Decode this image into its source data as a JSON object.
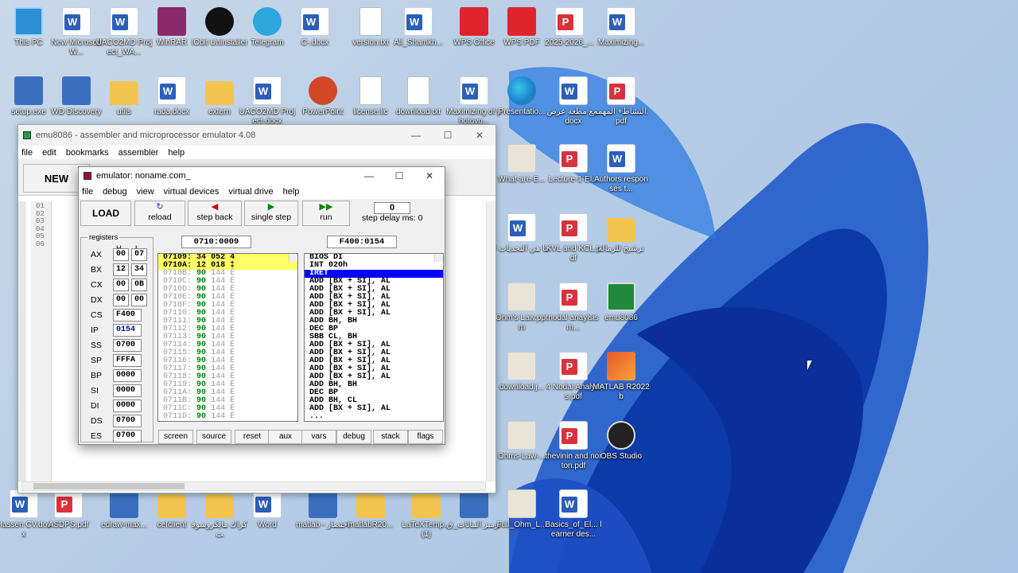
{
  "desktop": {
    "icons": [
      {
        "label": "This PC",
        "type": "pc"
      },
      {
        "label": "New Microsoft W...",
        "type": "word"
      },
      {
        "label": "UACO2MD Project_WA...",
        "type": "word"
      },
      {
        "label": "WinRAR",
        "type": "winrar"
      },
      {
        "label": "IObit Uninstaller",
        "type": "iobit"
      },
      {
        "label": "Telegram",
        "type": "tg"
      },
      {
        "label": "C-.docx",
        "type": "word"
      },
      {
        "label": "version.txt",
        "type": "txt"
      },
      {
        "label": "Ali_Shamkh...",
        "type": "word"
      },
      {
        "label": "WPS Office",
        "type": "wps"
      },
      {
        "label": "WPS PDF",
        "type": "wps"
      },
      {
        "label": "2025-2026_...",
        "type": "pdf"
      },
      {
        "label": "Maximizing...",
        "type": "word"
      },
      {
        "label": "setup.exe",
        "type": "app"
      },
      {
        "label": "WD Discovery",
        "type": "app"
      },
      {
        "label": "utils",
        "type": "folder"
      },
      {
        "label": "rada.docx",
        "type": "word"
      },
      {
        "label": "extern",
        "type": "folder"
      },
      {
        "label": "UACO2MD Project.docx",
        "type": "word"
      },
      {
        "label": "PowerPoint",
        "type": "ppt"
      },
      {
        "label": "license.lic",
        "type": "txt"
      },
      {
        "label": "download.txt",
        "type": "txt"
      },
      {
        "label": "Maximizing of photovo...",
        "type": "word"
      },
      {
        "label": "Presentatio...",
        "type": "edge"
      },
      {
        "label": "بيع مطعة عرض.docx",
        "type": "word"
      },
      {
        "label": "النشاط+ المهمه.pdf",
        "type": "pdf"
      },
      {
        "label": "What-are-E...",
        "type": "img"
      },
      {
        "label": "Lecture-1-El...",
        "type": "pdf"
      },
      {
        "label": "Authors responses t...",
        "type": "word"
      },
      {
        "label": "ما هي التحديات ا",
        "type": "word"
      },
      {
        "label": "KVL and KCL.pdf",
        "type": "pdf"
      },
      {
        "label": "ترشيح للزمالة",
        "type": "folder"
      },
      {
        "label": "Ohm's Law.pptm",
        "type": "img"
      },
      {
        "label": "nodal anaylsis m...",
        "type": "pdf"
      },
      {
        "label": "emu8086",
        "type": "chip"
      },
      {
        "label": "download.j...",
        "type": "img"
      },
      {
        "label": "4 Nodal Analysis.pdf",
        "type": "pdf"
      },
      {
        "label": "MATLAB R2022b",
        "type": "matlab"
      },
      {
        "label": "Ohms-Law-...",
        "type": "img"
      },
      {
        "label": "thevinin and norton.pdf",
        "type": "pdf"
      },
      {
        "label": "OBS Studio",
        "type": "obs"
      },
      {
        "label": "Hassen CV.docx",
        "type": "word"
      },
      {
        "label": "ASDPS.pdf",
        "type": "pdf"
      },
      {
        "label": "edraw-max...",
        "type": "app"
      },
      {
        "label": "cefclient",
        "type": "folder"
      },
      {
        "label": "كراك مايكروسوفت",
        "type": "folder"
      },
      {
        "label": "Word",
        "type": "word"
      },
      {
        "label": "matlab - اختصار",
        "type": "app"
      },
      {
        "label": "matlabR20...",
        "type": "folder"
      },
      {
        "label": "LaTeXTemp... (1)",
        "type": "folder"
      },
      {
        "label": "ترميز البيانات_ق",
        "type": "app"
      },
      {
        "label": "Full_Ohm_L...",
        "type": "img"
      },
      {
        "label": "Basics_of_El... learner des...",
        "type": "word"
      }
    ]
  },
  "outer_window": {
    "title": "emu8086 - assembler and microprocessor emulator 4.08",
    "menu": [
      "file",
      "edit",
      "bookmarks",
      "assembler",
      "help"
    ],
    "new_label": "NEW",
    "line_numbers": [
      "01",
      "02",
      "03",
      "04",
      "05",
      "06"
    ]
  },
  "emulator": {
    "title": "emulator: noname.com_",
    "menu": [
      "file",
      "debug",
      "view",
      "virtual devices",
      "virtual drive",
      "help"
    ],
    "load_label": "LOAD",
    "reload_label": "reload",
    "step_back_label": "step back",
    "single_step_label": "single step",
    "run_label": "run",
    "step_delay_label": "step delay ms: 0",
    "step_delay_value": "0",
    "mem_address": "0710:0009",
    "dis_address": "F400:0154",
    "registers_title": "registers",
    "col_h": "H",
    "col_l": "L",
    "registers": [
      {
        "name": "AX",
        "h": "00",
        "l": "07"
      },
      {
        "name": "BX",
        "h": "12",
        "l": "34"
      },
      {
        "name": "CX",
        "h": "00",
        "l": "0B"
      },
      {
        "name": "DX",
        "h": "00",
        "l": "00"
      },
      {
        "name": "CS",
        "v": "F400"
      },
      {
        "name": "IP",
        "v": "0154"
      },
      {
        "name": "SS",
        "v": "0700"
      },
      {
        "name": "SP",
        "v": "FFFA"
      },
      {
        "name": "BP",
        "v": "0000"
      },
      {
        "name": "SI",
        "v": "0000"
      },
      {
        "name": "DI",
        "v": "0000"
      },
      {
        "name": "DS",
        "v": "0700"
      },
      {
        "name": "ES",
        "v": "0700"
      }
    ],
    "memory": [
      {
        "addr": "07109:",
        "hex": "34",
        "dec": "052",
        "ch": "4",
        "hl": true
      },
      {
        "addr": "0710A:",
        "hex": "12",
        "dec": "018",
        "ch": "‡",
        "hl": true
      },
      {
        "addr": "0710B:",
        "hex": "90",
        "dec": "144",
        "ch": "É"
      },
      {
        "addr": "0710C:",
        "hex": "90",
        "dec": "144",
        "ch": "É"
      },
      {
        "addr": "0710D:",
        "hex": "90",
        "dec": "144",
        "ch": "É"
      },
      {
        "addr": "0710E:",
        "hex": "90",
        "dec": "144",
        "ch": "É"
      },
      {
        "addr": "0710F:",
        "hex": "90",
        "dec": "144",
        "ch": "É"
      },
      {
        "addr": "07110:",
        "hex": "90",
        "dec": "144",
        "ch": "É"
      },
      {
        "addr": "07111:",
        "hex": "90",
        "dec": "144",
        "ch": "É"
      },
      {
        "addr": "07112:",
        "hex": "90",
        "dec": "144",
        "ch": "É"
      },
      {
        "addr": "07113:",
        "hex": "90",
        "dec": "144",
        "ch": "É"
      },
      {
        "addr": "07114:",
        "hex": "90",
        "dec": "144",
        "ch": "É"
      },
      {
        "addr": "07115:",
        "hex": "90",
        "dec": "144",
        "ch": "É"
      },
      {
        "addr": "07116:",
        "hex": "90",
        "dec": "144",
        "ch": "É"
      },
      {
        "addr": "07117:",
        "hex": "90",
        "dec": "144",
        "ch": "É"
      },
      {
        "addr": "07118:",
        "hex": "90",
        "dec": "144",
        "ch": "É"
      },
      {
        "addr": "07119:",
        "hex": "90",
        "dec": "144",
        "ch": "É"
      },
      {
        "addr": "0711A:",
        "hex": "90",
        "dec": "144",
        "ch": "É"
      },
      {
        "addr": "0711B:",
        "hex": "90",
        "dec": "144",
        "ch": "É"
      },
      {
        "addr": "0711C:",
        "hex": "90",
        "dec": "144",
        "ch": "É"
      },
      {
        "addr": "0711D:",
        "hex": "90",
        "dec": "144",
        "ch": "É"
      }
    ],
    "disassembly": [
      "BIOS DI",
      "INT 020h",
      "IRET",
      "ADD [BX + SI], AL",
      "ADD [BX + SI], AL",
      "ADD [BX + SI], AL",
      "ADD [BX + SI], AL",
      "ADD [BX + SI], AL",
      "ADD BH, BH",
      "DEC BP",
      "SBB CL, BH",
      "ADD [BX + SI], AL",
      "ADD [BX + SI], AL",
      "ADD [BX + SI], AL",
      "ADD [BX + SI], AL",
      "ADD [BX + SI], AL",
      "ADD BH, BH",
      "DEC BP",
      "ADD BH, CL",
      "ADD [BX + SI], AL",
      "..."
    ],
    "selected_dis_index": 2,
    "bottom_buttons": [
      "screen",
      "source",
      "reset",
      "aux",
      "vars",
      "debug",
      "stack",
      "flags"
    ]
  }
}
